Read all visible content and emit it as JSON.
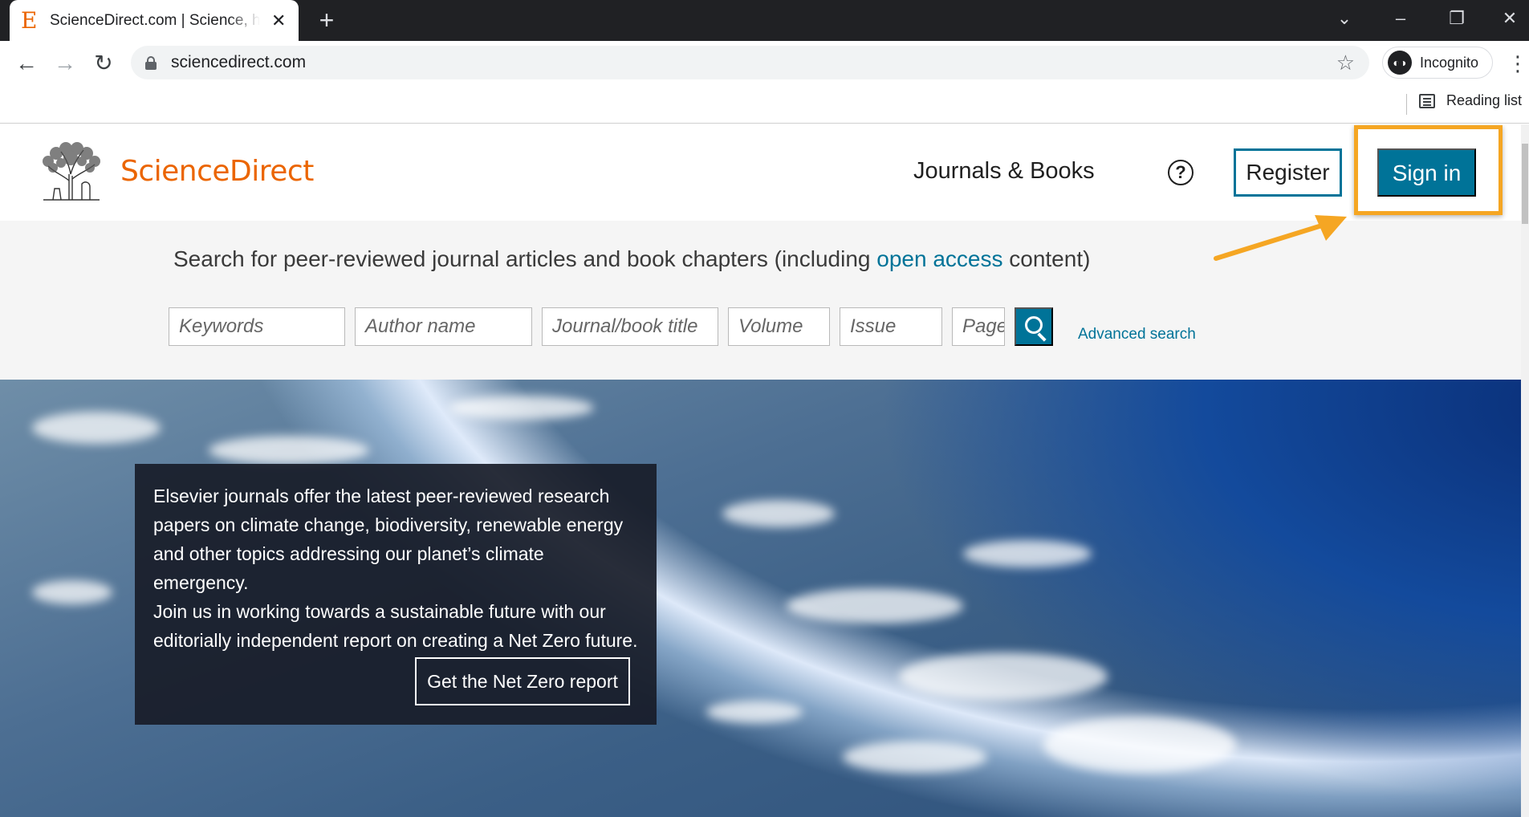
{
  "browser": {
    "tab_title": "ScienceDirect.com | Science, health and medical journals",
    "tab_favicon": "E",
    "url": "sciencedirect.com",
    "incognito_label": "Incognito",
    "reading_list_label": "Reading list",
    "icons": {
      "back": "back-arrow-icon",
      "forward": "forward-arrow-icon",
      "reload": "reload-icon",
      "lock": "lock-icon",
      "star": "star-icon",
      "incognito": "incognito-icon",
      "menu": "kebab-menu-icon",
      "reading_list": "reading-list-icon",
      "new_tab": "plus-icon",
      "close_tab": "close-icon"
    }
  },
  "header": {
    "brand": "ScienceDirect",
    "nav_journals": "Journals & Books",
    "help_symbol": "?",
    "register_label": "Register",
    "signin_label": "Sign in"
  },
  "search": {
    "lead_before": "Search for peer-reviewed journal articles and book chapters (including ",
    "lead_link": "open access",
    "lead_after": " content)",
    "fields": {
      "keywords": "Keywords",
      "author": "Author name",
      "journal": "Journal/book title",
      "volume": "Volume",
      "issue": "Issue",
      "pages": "Pages"
    },
    "advanced_label": "Advanced search"
  },
  "hero": {
    "text_line1": "Elsevier journals offer the latest peer-reviewed research papers on climate change, biodiversity, renewable energy and other topics addressing our planet’s climate emergency.",
    "text_line2": "Join us in working towards a sustainable future with our editorially independent report on creating a Net Zero future.",
    "cta_label": "Get the Net Zero report"
  },
  "colors": {
    "brand_orange": "#eb6500",
    "primary_blue": "#007398",
    "highlight": "#f5a623"
  }
}
